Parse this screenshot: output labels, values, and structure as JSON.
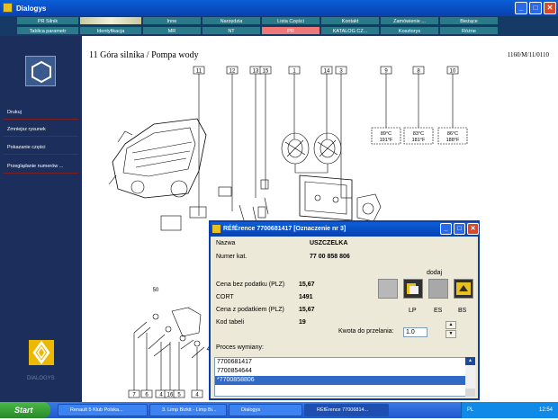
{
  "window": {
    "title": "Dialogys"
  },
  "menu": {
    "row1": [
      "PR Silnik",
      "",
      "Inne",
      "Narzędzia",
      "Lista Części",
      "Kontakt",
      "Zamówienie ...",
      "Bieżące"
    ],
    "row2": [
      "Tablica parametr",
      "Identyfikacja",
      "MR",
      "NT",
      "PR",
      "KATALOG CZ...",
      "Kosztorys",
      "Różne"
    ]
  },
  "sidebar": {
    "items": [
      "Drukuj",
      "Zmniejsz rysunek",
      "Pokazanie części",
      "Przeglądanie numerów ..."
    ],
    "brand": "DIALOGYS",
    "help": "Help"
  },
  "content": {
    "title": "11 Góra silnika / Pompa wody",
    "reference": "1160/M/11/0110",
    "callouts_top": [
      "11",
      "12",
      "13",
      "15",
      "1",
      "14",
      "3",
      "9",
      "8",
      "10"
    ],
    "callouts_bottom": [
      "7",
      "6",
      "4",
      "16",
      "5",
      "4"
    ],
    "temps": [
      {
        "c": "89°C",
        "f": "191°F"
      },
      {
        "c": "83°C",
        "f": "181°F"
      },
      {
        "c": "86°C",
        "f": "188°F"
      }
    ],
    "drawing_marks": [
      "50",
      "40"
    ]
  },
  "dialog": {
    "title": "RÉfÉrence 7700681417 [Oznaczenie nr 3]",
    "nazwa_label": "Nazwa",
    "nazwa_value": "USZCZELKA",
    "numer_label": "Numer kat.",
    "numer_value": "77 00 858 806",
    "dodaj_label": "dodaj",
    "cena_bez_label": "Cena bez podatku (PLZ)",
    "cena_bez_value": "15,67",
    "cort_label": "CORT",
    "cort_value": "1491",
    "cena_z_label": "Cena z podatkiem (PLZ)",
    "cena_z_value": "15,67",
    "kod_label": "Kod tabeli",
    "kod_value": "19",
    "kwota_label": "Kwota do przelania:",
    "kwota_value": "1.0",
    "proces_label": "Proces wymiany:",
    "icon_labels": [
      "LP",
      "ES",
      "BS"
    ],
    "proces_items": [
      "7700681417",
      "7700854644",
      "*7700858806"
    ]
  },
  "taskbar": {
    "start": "Start",
    "buttons": [
      "Renault 5 Klub Polska...",
      "3. Limp Bizkit - Limp Bi...",
      "Dialogys",
      "RÉfÉrence 77006814..."
    ],
    "lang": "PL",
    "clock": "12:54"
  }
}
